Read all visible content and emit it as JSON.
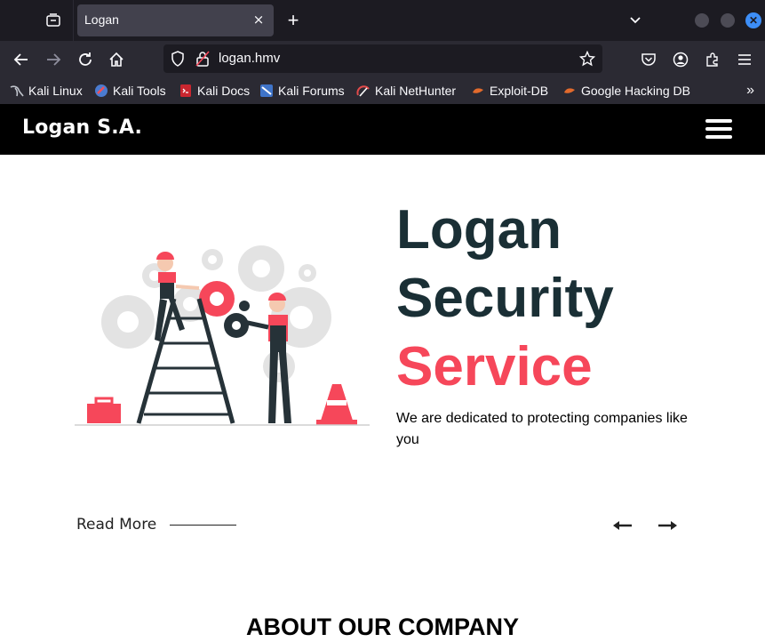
{
  "browser": {
    "tab_title": "Logan",
    "tab_close": "×",
    "new_tab": "+",
    "url": "logan.hmv",
    "bookmarks": [
      {
        "label": "Kali Linux",
        "icon": "kali-dragon-icon"
      },
      {
        "label": "Kali Tools",
        "icon": "kali-tools-icon"
      },
      {
        "label": "Kali Docs",
        "icon": "kali-docs-icon"
      },
      {
        "label": "Kali Forums",
        "icon": "kali-forums-icon"
      },
      {
        "label": "Kali NetHunter",
        "icon": "nethunter-icon"
      },
      {
        "label": "Exploit-DB",
        "icon": "exploit-db-icon"
      },
      {
        "label": "Google Hacking DB",
        "icon": "ghdb-icon"
      }
    ],
    "bookmarks_more": "»"
  },
  "site": {
    "brand": "Logan S.A.",
    "hero": {
      "title_line1": "Logan",
      "title_line2": "Security",
      "title_line3": "Service",
      "subtitle": "We are dedicated to protecting companies like you",
      "read_more": "Read More"
    },
    "about_title": "ABOUT OUR COMPANY"
  },
  "colors": {
    "accent": "#f6475a",
    "heading": "#1a2f35",
    "header_bg": "#000000",
    "chrome_dark": "#1c1b22",
    "chrome_bar": "#2b2a33"
  }
}
